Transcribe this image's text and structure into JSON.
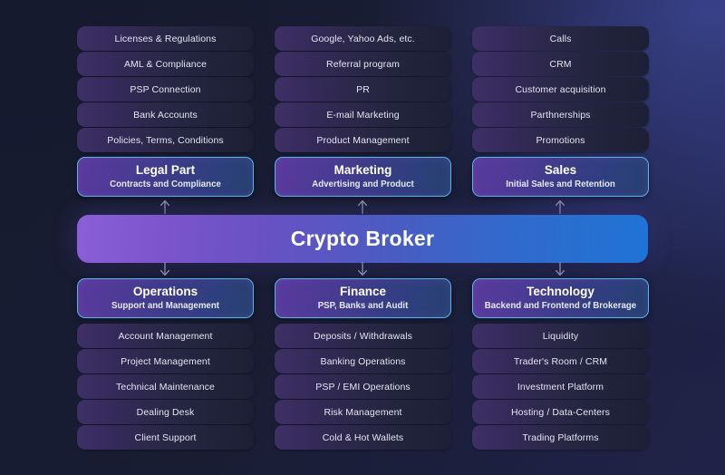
{
  "hero": {
    "title": "Crypto Broker",
    "gradient_from": "#8b5fd6",
    "gradient_to": "#1f73d6"
  },
  "theme": {
    "background": "#191d33",
    "leaf_gradient_from": "#3e3066",
    "leaf_gradient_to": "#1c2035",
    "dept_gradient_from": "#5b3a9e",
    "dept_gradient_to": "#27416f",
    "dept_border": "#59b4f0",
    "arrow_color": "#8e8ab8",
    "text_primary": "#ffffff",
    "text_secondary": "#e3e5f2"
  },
  "columns": [
    {
      "id": "legal",
      "position": "top-left",
      "department": {
        "title": "Legal Part",
        "subtitle": "Contracts and Compliance"
      },
      "items": [
        "Licenses & Regulations",
        "AML & Compliance",
        "PSP Connection",
        "Bank Accounts",
        "Policies, Terms, Conditions"
      ],
      "arrow": "up"
    },
    {
      "id": "marketing",
      "position": "top-center",
      "department": {
        "title": "Marketing",
        "subtitle": "Advertising and Product"
      },
      "items": [
        "Google, Yahoo Ads, etc.",
        "Referral program",
        "PR",
        "E-mail Marketing",
        "Product Management"
      ],
      "arrow": "up"
    },
    {
      "id": "sales",
      "position": "top-right",
      "department": {
        "title": "Sales",
        "subtitle": "Initial Sales and Retention"
      },
      "items": [
        "Calls",
        "CRM",
        "Customer acquisition",
        "Parthnerships",
        "Promotions"
      ],
      "arrow": "up"
    },
    {
      "id": "operations",
      "position": "bottom-left",
      "department": {
        "title": "Operations",
        "subtitle": "Support and Management"
      },
      "items": [
        "Account Management",
        "Project Management",
        "Technical Maintenance",
        "Dealing Desk",
        "Client Support"
      ],
      "arrow": "down"
    },
    {
      "id": "finance",
      "position": "bottom-center",
      "department": {
        "title": "Finance",
        "subtitle": "PSP, Banks and Audit"
      },
      "items": [
        "Deposits / Withdrawals",
        "Banking Operations",
        "PSP / EMI Operations",
        "Risk Management",
        "Cold & Hot Wallets"
      ],
      "arrow": "down"
    },
    {
      "id": "technology",
      "position": "bottom-right",
      "department": {
        "title": "Technology",
        "subtitle": "Backend and Frontend of Brokerage"
      },
      "items": [
        "Liquidity",
        "Trader's Room / CRM",
        "Investment Platform",
        "Hosting / Data-Centers",
        "Trading Platforms"
      ],
      "arrow": "down"
    }
  ]
}
